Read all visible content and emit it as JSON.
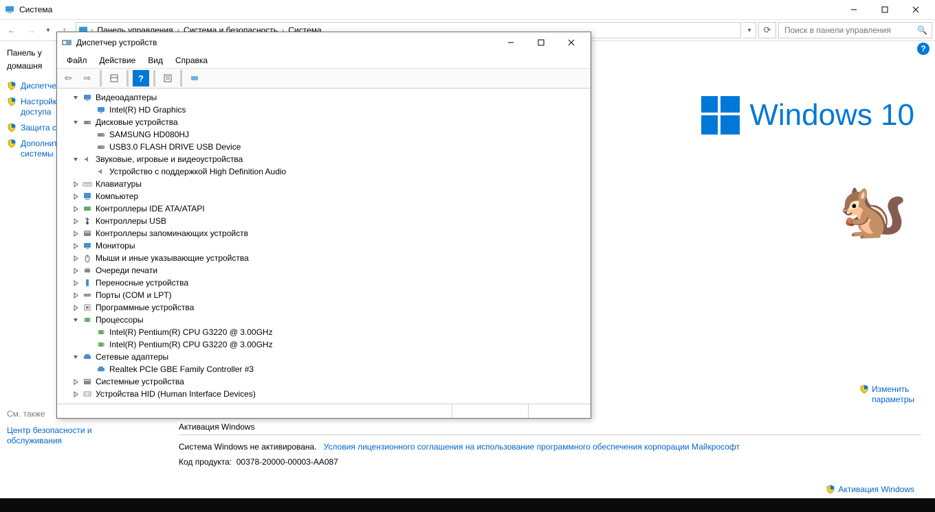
{
  "sys": {
    "title": "Система",
    "breadcrumb": [
      "Панель управления",
      "Система и безопасность",
      "Система"
    ],
    "search_placeholder": "Поиск в панели управления"
  },
  "left": {
    "header1": "Панель у",
    "header2": "домашня",
    "items": [
      {
        "label": "Диспетчер"
      },
      {
        "label": "Настройки\nдоступа"
      },
      {
        "label": "Защита с"
      },
      {
        "label": "Дополнит\nсистемы"
      }
    ],
    "see_also": "См. также",
    "sa_link": "Центр безопасности и\nобслуживания"
  },
  "brand": {
    "text": "Windows 10"
  },
  "rightlinks": {
    "change_params": "Изменить\nпараметры"
  },
  "activation": {
    "header": "Активация Windows",
    "line1_a": "Система Windows не активирована.",
    "line1_link": "Условия лицензионного соглашения на использование программного обеспечения корпорации Майкрософт",
    "line2_label": "Код продукта:",
    "line2_value": "00378-20000-00003-AA087",
    "activate_link": "Активация Windows"
  },
  "dm": {
    "title": "Диспетчер устройств",
    "menu": [
      "Файл",
      "Действие",
      "Вид",
      "Справка"
    ],
    "tree": [
      {
        "indent": 0,
        "exp": "open",
        "icon": "monitor",
        "label": "Видеоадаптеры"
      },
      {
        "indent": 1,
        "exp": "",
        "icon": "monitor",
        "label": "Intel(R) HD Graphics"
      },
      {
        "indent": 0,
        "exp": "open",
        "icon": "disk",
        "label": "Дисковые устройства"
      },
      {
        "indent": 1,
        "exp": "",
        "icon": "disk",
        "label": "SAMSUNG HD080HJ"
      },
      {
        "indent": 1,
        "exp": "",
        "icon": "disk",
        "label": "USB3.0 FLASH DRIVE USB Device"
      },
      {
        "indent": 0,
        "exp": "open",
        "icon": "audio",
        "label": "Звуковые, игровые и видеоустройства"
      },
      {
        "indent": 1,
        "exp": "",
        "icon": "audio",
        "label": "Устройство с поддержкой High Definition Audio"
      },
      {
        "indent": 0,
        "exp": "closed",
        "icon": "keyboard",
        "label": "Клавиатуры"
      },
      {
        "indent": 0,
        "exp": "closed",
        "icon": "computer",
        "label": "Компьютер"
      },
      {
        "indent": 0,
        "exp": "closed",
        "icon": "ide",
        "label": "Контроллеры IDE ATA/ATAPI"
      },
      {
        "indent": 0,
        "exp": "closed",
        "icon": "usb",
        "label": "Контроллеры USB"
      },
      {
        "indent": 0,
        "exp": "closed",
        "icon": "storage",
        "label": "Контроллеры запоминающих устройств"
      },
      {
        "indent": 0,
        "exp": "closed",
        "icon": "monitor",
        "label": "Мониторы"
      },
      {
        "indent": 0,
        "exp": "closed",
        "icon": "mouse",
        "label": "Мыши и иные указывающие устройства"
      },
      {
        "indent": 0,
        "exp": "closed",
        "icon": "print",
        "label": "Очереди печати"
      },
      {
        "indent": 0,
        "exp": "closed",
        "icon": "portable",
        "label": "Переносные устройства"
      },
      {
        "indent": 0,
        "exp": "closed",
        "icon": "port",
        "label": "Порты (COM и LPT)"
      },
      {
        "indent": 0,
        "exp": "closed",
        "icon": "soft",
        "label": "Программные устройства"
      },
      {
        "indent": 0,
        "exp": "open",
        "icon": "cpu",
        "label": "Процессоры"
      },
      {
        "indent": 1,
        "exp": "",
        "icon": "cpu",
        "label": "Intel(R) Pentium(R) CPU G3220 @ 3.00GHz"
      },
      {
        "indent": 1,
        "exp": "",
        "icon": "cpu",
        "label": "Intel(R) Pentium(R) CPU G3220 @ 3.00GHz"
      },
      {
        "indent": 0,
        "exp": "open",
        "icon": "net",
        "label": "Сетевые адаптеры"
      },
      {
        "indent": 1,
        "exp": "",
        "icon": "net",
        "label": "Realtek PCIe GBE Family Controller #3"
      },
      {
        "indent": 0,
        "exp": "closed",
        "icon": "system",
        "label": "Системные устройства"
      },
      {
        "indent": 0,
        "exp": "closed",
        "icon": "hid",
        "label": "Устройства HID (Human Interface Devices)"
      }
    ]
  }
}
